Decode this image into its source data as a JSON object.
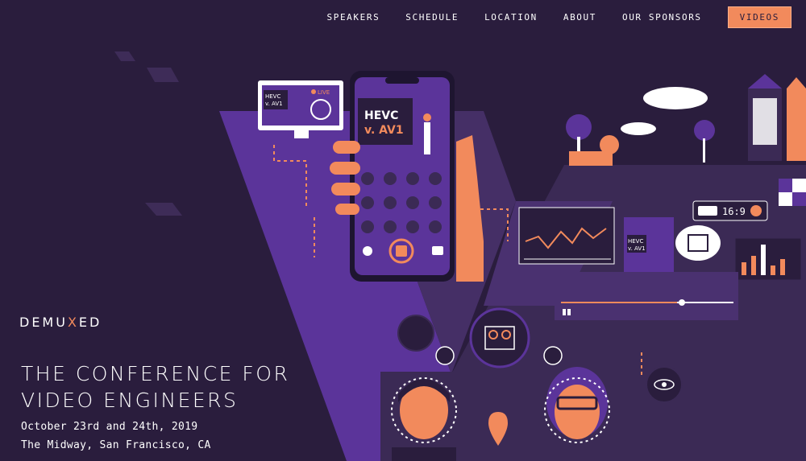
{
  "nav": {
    "items": [
      "SPEAKERS",
      "SCHEDULE",
      "LOCATION",
      "ABOUT",
      "OUR SPONSORS"
    ],
    "cta_label": "VIDEOS"
  },
  "brand": {
    "prefix": "DEMU",
    "x": "X",
    "suffix": "ED"
  },
  "hero": {
    "headline": "THE CONFERENCE FOR VIDEO ENGINEERS",
    "date": "October 23rd and 24th, 2019",
    "venue": "The Midway, San Francisco, CA"
  },
  "illustration": {
    "monitor_screen_text": "HEVC v. AV1",
    "monitor_live_badge": "LIVE",
    "phone_screen_text_line1": "HEVC",
    "phone_screen_text_line2": "v. AV1",
    "stage_screen_text": "HEVC v. AV1",
    "aspect_ratio_label": "16:9"
  },
  "colors": {
    "background": "#2a1d3d",
    "purple": "#6b3fa0",
    "deep_purple": "#3b2a55",
    "accent_orange": "#f28a5c",
    "panel_dark": "#33254a"
  }
}
